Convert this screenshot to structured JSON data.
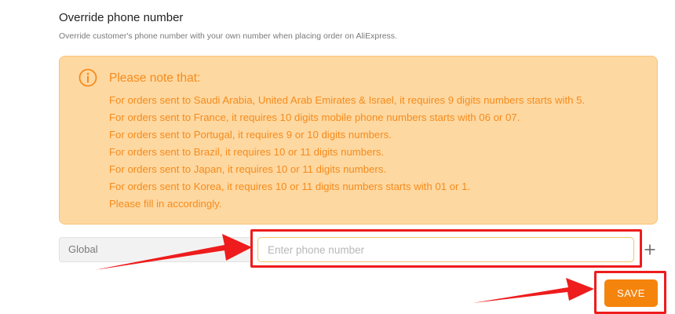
{
  "section": {
    "title": "Override phone number",
    "description": "Override customer's phone number with your own number when placing order on AliExpress."
  },
  "notice": {
    "icon": "info-circle-icon",
    "title": "Please note that:",
    "lines": [
      "For orders sent to Saudi Arabia, United Arab Emirates & Israel, it requires 9 digits numbers starts with 5.",
      "For orders sent to France, it requires 10 digits mobile phone numbers starts with 06 or 07.",
      "For orders sent to Portugal, it requires 9 or 10 digits numbers.",
      "For orders sent to Brazil, it requires 10 or 11 digits numbers.",
      "For orders sent to Japan, it requires 10 or 11 digits numbers.",
      "For orders sent to Korea, it requires 10 or 11 digits numbers starts with 01 or 1.",
      "Please fill in accordingly."
    ]
  },
  "phone_row": {
    "region_value": "Global",
    "input_value": "",
    "input_placeholder": "Enter phone number",
    "add_icon": "plus-icon"
  },
  "actions": {
    "save_label": "SAVE"
  },
  "colors": {
    "accent": "#f5840c",
    "notice_bg": "#fed8a1",
    "notice_text": "#f58b1c",
    "highlight": "#ee1c1c"
  }
}
